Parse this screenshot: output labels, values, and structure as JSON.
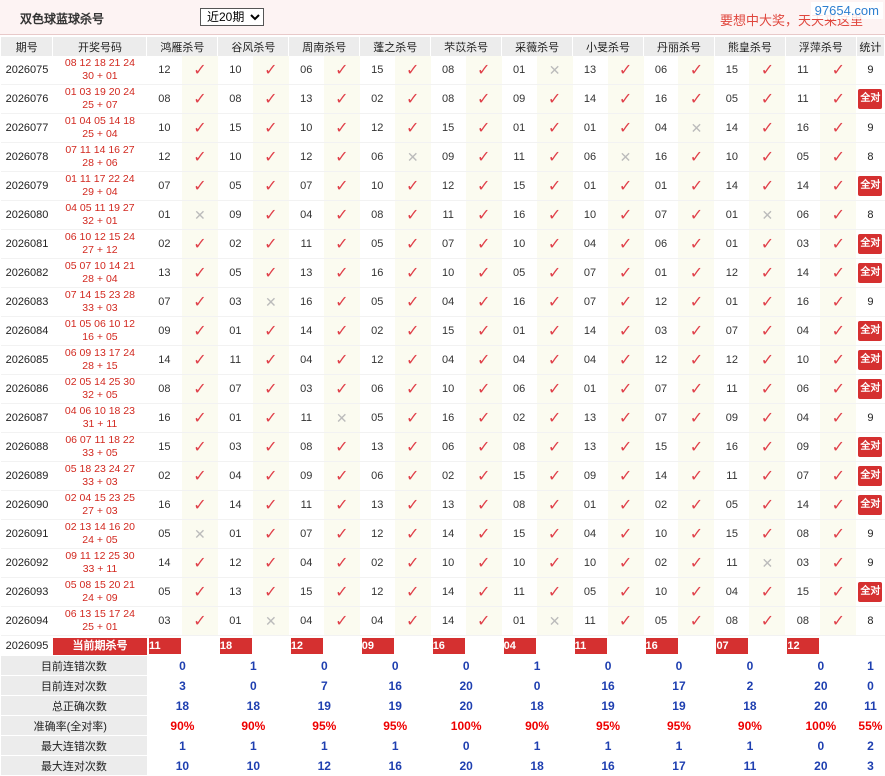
{
  "header": {
    "title": "双色球蓝球杀号",
    "select_value": "近20期",
    "slogan": "要想中大奖，天天来这里"
  },
  "watermark": "97654.com",
  "columns": {
    "period": "期号",
    "draw": "开奖号码",
    "stat": "统计",
    "experts": [
      "鸿雁杀号",
      "谷风杀号",
      "周南杀号",
      "蓬之杀号",
      "芣苡杀号",
      "采薇杀号",
      "小旻杀号",
      "丹丽杀号",
      "熊皇杀号",
      "浮萍杀号"
    ]
  },
  "full_label": "全对",
  "rows": [
    {
      "period": "2026075",
      "draw_red": "08 12 18 21 24",
      "draw_blue": "30 + 01",
      "kills": [
        "12",
        "10",
        "06",
        "15",
        "08",
        "01",
        "13",
        "06",
        "15",
        "11"
      ],
      "hits": [
        1,
        1,
        1,
        1,
        1,
        0,
        1,
        1,
        1,
        1
      ],
      "stat": "9"
    },
    {
      "period": "2026076",
      "draw_red": "01 03 19 20 24",
      "draw_blue": "25 + 07",
      "kills": [
        "08",
        "08",
        "13",
        "02",
        "08",
        "09",
        "14",
        "16",
        "05",
        "11"
      ],
      "hits": [
        1,
        1,
        1,
        1,
        1,
        1,
        1,
        1,
        1,
        1
      ],
      "stat": "全对"
    },
    {
      "period": "2026077",
      "draw_red": "01 04 05 14 18",
      "draw_blue": "25 + 04",
      "kills": [
        "10",
        "15",
        "10",
        "12",
        "15",
        "01",
        "01",
        "04",
        "14",
        "16"
      ],
      "hits": [
        1,
        1,
        1,
        1,
        1,
        1,
        1,
        0,
        1,
        1
      ],
      "stat": "9"
    },
    {
      "period": "2026078",
      "draw_red": "07 11 14 16 27",
      "draw_blue": "28 + 06",
      "kills": [
        "12",
        "10",
        "12",
        "06",
        "09",
        "11",
        "06",
        "16",
        "10",
        "05"
      ],
      "hits": [
        1,
        1,
        1,
        0,
        1,
        1,
        0,
        1,
        1,
        1
      ],
      "stat": "8"
    },
    {
      "period": "2026079",
      "draw_red": "01 11 17 22 24",
      "draw_blue": "29 + 04",
      "kills": [
        "07",
        "05",
        "07",
        "10",
        "12",
        "15",
        "01",
        "01",
        "14",
        "14"
      ],
      "hits": [
        1,
        1,
        1,
        1,
        1,
        1,
        1,
        1,
        1,
        1
      ],
      "stat": "全对"
    },
    {
      "period": "2026080",
      "draw_red": "04 05 11 19 27",
      "draw_blue": "32 + 01",
      "kills": [
        "01",
        "09",
        "04",
        "08",
        "11",
        "16",
        "10",
        "07",
        "01",
        "06"
      ],
      "hits": [
        0,
        1,
        1,
        1,
        1,
        1,
        1,
        1,
        0,
        1
      ],
      "stat": "8"
    },
    {
      "period": "2026081",
      "draw_red": "06 10 12 15 24",
      "draw_blue": "27 + 12",
      "kills": [
        "02",
        "02",
        "11",
        "05",
        "07",
        "10",
        "04",
        "06",
        "01",
        "03"
      ],
      "hits": [
        1,
        1,
        1,
        1,
        1,
        1,
        1,
        1,
        1,
        1
      ],
      "stat": "全对"
    },
    {
      "period": "2026082",
      "draw_red": "05 07 10 14 21",
      "draw_blue": "28 + 04",
      "kills": [
        "13",
        "05",
        "13",
        "16",
        "10",
        "05",
        "07",
        "01",
        "12",
        "14"
      ],
      "hits": [
        1,
        1,
        1,
        1,
        1,
        1,
        1,
        1,
        1,
        1
      ],
      "stat": "全对"
    },
    {
      "period": "2026083",
      "draw_red": "07 14 15 23 28",
      "draw_blue": "33 + 03",
      "kills": [
        "07",
        "03",
        "16",
        "05",
        "04",
        "16",
        "07",
        "12",
        "01",
        "16"
      ],
      "hits": [
        1,
        0,
        1,
        1,
        1,
        1,
        1,
        1,
        1,
        1
      ],
      "stat": "9"
    },
    {
      "period": "2026084",
      "draw_red": "01 05 06 10 12",
      "draw_blue": "16 + 05",
      "kills": [
        "09",
        "01",
        "14",
        "02",
        "15",
        "01",
        "14",
        "03",
        "07",
        "04"
      ],
      "hits": [
        1,
        1,
        1,
        1,
        1,
        1,
        1,
        1,
        1,
        1
      ],
      "stat": "全对"
    },
    {
      "period": "2026085",
      "draw_red": "06 09 13 17 24",
      "draw_blue": "28 + 15",
      "kills": [
        "14",
        "11",
        "04",
        "12",
        "04",
        "04",
        "04",
        "12",
        "12",
        "10"
      ],
      "hits": [
        1,
        1,
        1,
        1,
        1,
        1,
        1,
        1,
        1,
        1
      ],
      "stat": "全对"
    },
    {
      "period": "2026086",
      "draw_red": "02 05 14 25 30",
      "draw_blue": "32 + 05",
      "kills": [
        "08",
        "07",
        "03",
        "06",
        "10",
        "06",
        "01",
        "07",
        "11",
        "06"
      ],
      "hits": [
        1,
        1,
        1,
        1,
        1,
        1,
        1,
        1,
        1,
        1
      ],
      "stat": "全对"
    },
    {
      "period": "2026087",
      "draw_red": "04 06 10 18 23",
      "draw_blue": "31 + 11",
      "kills": [
        "16",
        "01",
        "11",
        "05",
        "16",
        "02",
        "13",
        "07",
        "09",
        "04"
      ],
      "hits": [
        1,
        1,
        0,
        1,
        1,
        1,
        1,
        1,
        1,
        1
      ],
      "stat": "9"
    },
    {
      "period": "2026088",
      "draw_red": "06 07 11 18 22",
      "draw_blue": "33 + 05",
      "kills": [
        "15",
        "03",
        "08",
        "13",
        "06",
        "08",
        "13",
        "15",
        "16",
        "09"
      ],
      "hits": [
        1,
        1,
        1,
        1,
        1,
        1,
        1,
        1,
        1,
        1
      ],
      "stat": "全对"
    },
    {
      "period": "2026089",
      "draw_red": "05 18 23 24 27",
      "draw_blue": "33 + 03",
      "kills": [
        "02",
        "04",
        "09",
        "06",
        "02",
        "15",
        "09",
        "14",
        "11",
        "07"
      ],
      "hits": [
        1,
        1,
        1,
        1,
        1,
        1,
        1,
        1,
        1,
        1
      ],
      "stat": "全对"
    },
    {
      "period": "2026090",
      "draw_red": "02 04 15 23 25",
      "draw_blue": "27 + 03",
      "kills": [
        "16",
        "14",
        "11",
        "13",
        "13",
        "08",
        "01",
        "02",
        "05",
        "14"
      ],
      "hits": [
        1,
        1,
        1,
        1,
        1,
        1,
        1,
        1,
        1,
        1
      ],
      "stat": "全对"
    },
    {
      "period": "2026091",
      "draw_red": "02 13 14 16 20",
      "draw_blue": "24 + 05",
      "kills": [
        "05",
        "01",
        "07",
        "12",
        "14",
        "15",
        "04",
        "10",
        "15",
        "08"
      ],
      "hits": [
        0,
        1,
        1,
        1,
        1,
        1,
        1,
        1,
        1,
        1
      ],
      "stat": "9"
    },
    {
      "period": "2026092",
      "draw_red": "09 11 12 25 30",
      "draw_blue": "33 + 11",
      "kills": [
        "14",
        "12",
        "04",
        "02",
        "10",
        "10",
        "10",
        "02",
        "11",
        "03"
      ],
      "hits": [
        1,
        1,
        1,
        1,
        1,
        1,
        1,
        1,
        0,
        1
      ],
      "stat": "9"
    },
    {
      "period": "2026093",
      "draw_red": "05 08 15 20 21",
      "draw_blue": "24 + 09",
      "kills": [
        "05",
        "13",
        "15",
        "12",
        "14",
        "11",
        "05",
        "10",
        "04",
        "15"
      ],
      "hits": [
        1,
        1,
        1,
        1,
        1,
        1,
        1,
        1,
        1,
        1
      ],
      "stat": "全对"
    },
    {
      "period": "2026094",
      "draw_red": "06 13 15 17 24",
      "draw_blue": "25 + 01",
      "kills": [
        "03",
        "01",
        "04",
        "04",
        "14",
        "01",
        "11",
        "05",
        "08",
        "08"
      ],
      "hits": [
        1,
        0,
        1,
        1,
        1,
        0,
        1,
        1,
        1,
        1
      ],
      "stat": "8"
    }
  ],
  "current": {
    "period": "2026095",
    "label": "当前期杀号",
    "kills": [
      "11",
      "18",
      "12",
      "09",
      "16",
      "04",
      "11",
      "16",
      "07",
      "12"
    ]
  },
  "summary": [
    {
      "label": "目前连错次数",
      "values": [
        "0",
        "1",
        "0",
        "0",
        "0",
        "1",
        "0",
        "0",
        "0",
        "0",
        "1"
      ],
      "red": false
    },
    {
      "label": "目前连对次数",
      "values": [
        "3",
        "0",
        "7",
        "16",
        "20",
        "0",
        "16",
        "17",
        "2",
        "20",
        "0"
      ],
      "red": false
    },
    {
      "label": "总正确次数",
      "values": [
        "18",
        "18",
        "19",
        "19",
        "20",
        "18",
        "19",
        "19",
        "18",
        "20",
        "11"
      ],
      "red": false
    },
    {
      "label": "准确率(全对率)",
      "values": [
        "90%",
        "90%",
        "95%",
        "95%",
        "100%",
        "90%",
        "95%",
        "95%",
        "90%",
        "100%",
        "55%"
      ],
      "red": true
    },
    {
      "label": "最大连错次数",
      "values": [
        "1",
        "1",
        "1",
        "1",
        "0",
        "1",
        "1",
        "1",
        "1",
        "0",
        "2"
      ],
      "red": false
    },
    {
      "label": "最大连对次数",
      "values": [
        "10",
        "10",
        "12",
        "16",
        "20",
        "18",
        "16",
        "17",
        "11",
        "20",
        "3"
      ],
      "red": false
    }
  ],
  "icons": {
    "hit": "check-icon",
    "miss": "cross-icon"
  },
  "colors": {
    "accent": "#d53030",
    "check": "#e0404a",
    "miss": "#bbbbbb",
    "value_blue": "#1e3fb0"
  }
}
